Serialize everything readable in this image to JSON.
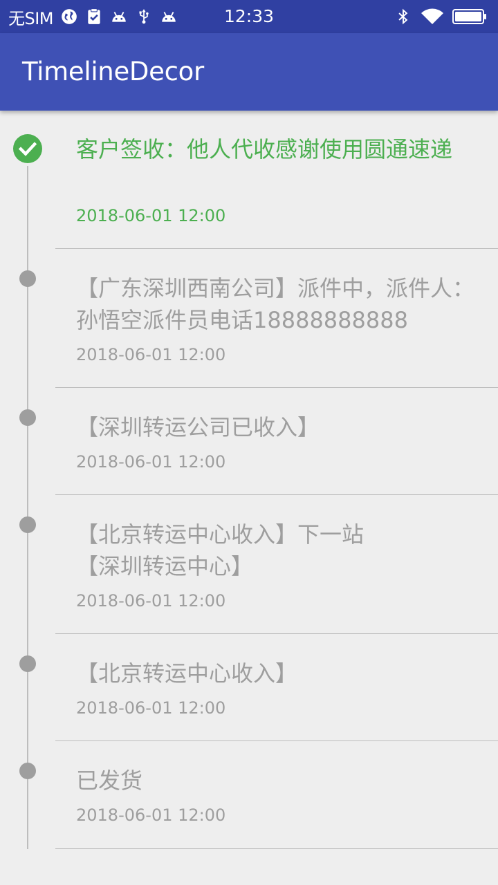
{
  "status_bar": {
    "carrier": "无SIM",
    "time": "12:33",
    "left_icons": [
      "globe-icon",
      "clipboard-check-icon",
      "android-icon",
      "usb-icon",
      "android-icon"
    ],
    "right_icons": [
      "bluetooth-icon",
      "wifi-icon",
      "battery-icon"
    ]
  },
  "app_bar": {
    "title": "TimelineDecor",
    "color": "#3f51b5"
  },
  "timeline": {
    "accent_color": "#4caf50",
    "inactive_color": "#9e9e9e",
    "items": [
      {
        "text": "客户签收：他人代收感谢使用圆通速递",
        "time": "2018-06-01 12:00",
        "current": true
      },
      {
        "text": "【广东深圳西南公司】派件中，派件人：孙悟空派件员电话18888888888",
        "time": "2018-06-01 12:00",
        "current": false
      },
      {
        "text": "【深圳转运公司已收入】",
        "time": "2018-06-01 12:00",
        "current": false
      },
      {
        "text": "【北京转运中心收入】下一站【深圳转运中心】",
        "time": "2018-06-01 12:00",
        "current": false
      },
      {
        "text": "【北京转运中心收入】",
        "time": "2018-06-01 12:00",
        "current": false
      },
      {
        "text": "已发货",
        "time": "2018-06-01 12:00",
        "current": false
      }
    ]
  }
}
